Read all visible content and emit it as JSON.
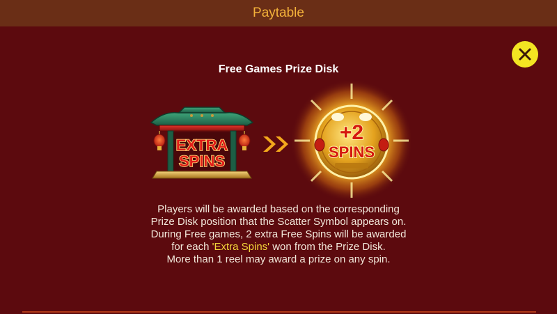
{
  "header": {
    "title": "Paytable"
  },
  "close_button": {
    "icon": "close-icon"
  },
  "section": {
    "title": "Free Games Prize Disk"
  },
  "symbols": {
    "extra_spins": {
      "line1": "EXTRA",
      "line2": "SPINS"
    },
    "arrow": {
      "icon": "double-chevron-right-icon"
    },
    "prize_disk": {
      "line1": "+2",
      "line2": "SPINS"
    }
  },
  "description": {
    "line1": "Players will be awarded based on the corresponding",
    "line2": "Prize Disk position that the Scatter Symbol appears on.",
    "line3": "During Free games, 2 extra Free Spins will be awarded",
    "line4_before": "for each ",
    "line4_highlight": "'Extra Spins'",
    "line4_after": " won from the Prize Disk.",
    "line5": "More than 1 reel may award a prize on any spin."
  },
  "colors": {
    "background": "#5c0a0e",
    "header_bar": "#6a2e16",
    "header_text": "#f4b23a",
    "close_button": "#f3e522",
    "highlight_text": "#f3d53a",
    "body_text": "#f2e7da"
  }
}
